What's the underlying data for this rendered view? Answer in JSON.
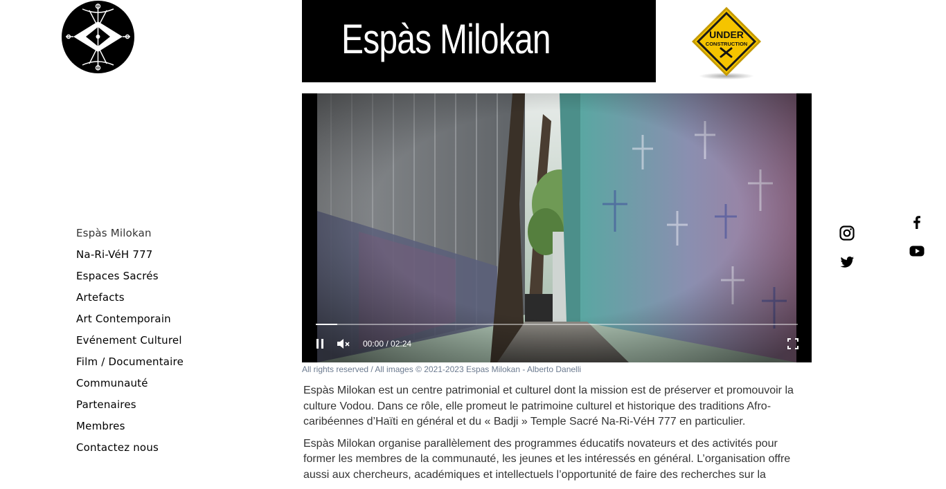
{
  "site": {
    "title": "Espàs Milokan",
    "logo_icon": "veve-logo-icon",
    "construction_sign": {
      "line1": "UNDER",
      "line2": "CONSTRUCTION",
      "icon": "tools-icon"
    }
  },
  "nav": {
    "items": [
      {
        "label": "Espàs Milokan",
        "active": true
      },
      {
        "label": "Na-Ri-VéH 777"
      },
      {
        "label": "Espaces Sacrés"
      },
      {
        "label": "Artefacts"
      },
      {
        "label": "Art Contemporain"
      },
      {
        "label": "Evénement Culturel"
      },
      {
        "label": "Film / Documentaire"
      },
      {
        "label": "Communauté"
      },
      {
        "label": "Partenaires"
      },
      {
        "label": "Membres"
      },
      {
        "label": "Contactez nous"
      }
    ]
  },
  "video": {
    "time": "00:00 / 02:24",
    "progress": 0.045,
    "muted": true,
    "playing": true
  },
  "caption": "All rights reserved / All images © 2021-2023 Espas Milokan - Alberto Danelli",
  "paragraphs": [
    "Espàs Milokan est un centre patrimonial et culturel dont la mission est de préserver et promouvoir la culture Vodou.  Dans ce rôle, elle promeut le patrimoine culturel et historique des traditions Afro-caribéennes d’Haïti en général et du « Badji » Temple Sacré Na-Ri-VéH 777 en particulier.",
    "Espàs Milokan organise parallèlement des programmes éducatifs novateurs et des activités pour former les membres de la communauté, les jeunes et les intéressés en général. L’organisation offre aussi aux chercheurs, académiques et intellectuels l’opportunité de faire des recherches sur la"
  ],
  "social": [
    "instagram-icon",
    "twitter-icon",
    "facebook-icon",
    "youtube-icon"
  ],
  "colors": {
    "banner": "#000000",
    "caption": "#6b7a8f",
    "sign_yellow": "#f5c400"
  }
}
